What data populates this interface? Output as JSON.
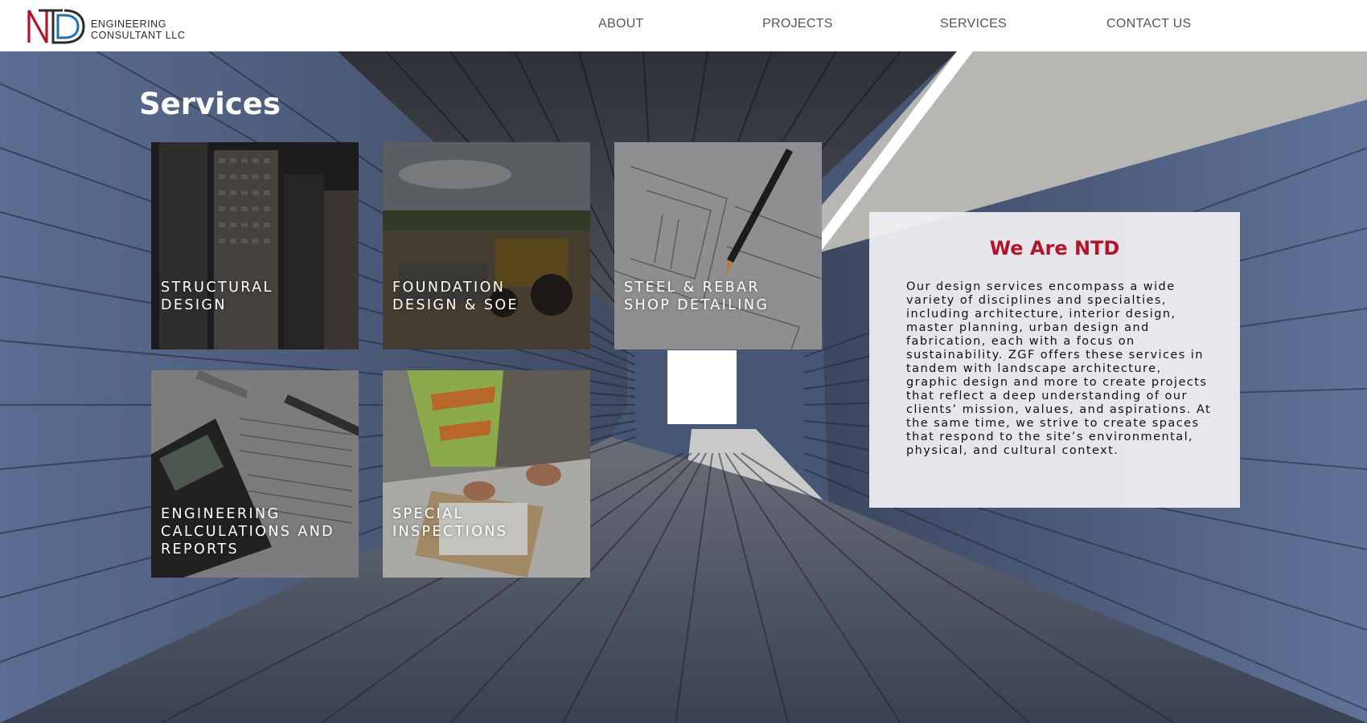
{
  "brand": {
    "logo_mark": "NTD",
    "name_line1": "ENGINEERING",
    "name_line2": "CONSULTANT LLC"
  },
  "nav": [
    {
      "label": "ABOUT"
    },
    {
      "label": "PROJECTS"
    },
    {
      "label": "SERVICES"
    },
    {
      "label": "CONTACT US"
    }
  ],
  "services": {
    "title": "Services",
    "tiles": [
      {
        "line1": "STRUCTURAL",
        "line2": "DESIGN",
        "line3": ""
      },
      {
        "line1": "FOUNDATION",
        "line2": "DESIGN & SOE",
        "line3": ""
      },
      {
        "line1": "STEEL & REBAR",
        "line2": "SHOP DETAILING",
        "line3": ""
      },
      {
        "line1": "ENGINEERING",
        "line2": "CALCULATIONS AND",
        "line3": "REPORTS"
      },
      {
        "line1": "SPECIAL",
        "line2": "INSPECTIONS",
        "line3": ""
      }
    ]
  },
  "about": {
    "title": "We Are NTD",
    "body": "Our design services encompass a wide variety of disciplines and specialties, including architecture, interior design, master planning, urban design and fabrication, each with a focus on sustainability. ZGF offers these services in tandem with landscape architecture, graphic design and more to create projects that reflect a deep understanding of our clients’ mission, values, and aspirations. At the same time, we strive to create spaces that respond to the site’s environmental, physical, and cultural context."
  },
  "colors": {
    "accent_red": "#b3142b",
    "logo_blue": "#1f6fb2",
    "nav_text": "#555555"
  }
}
